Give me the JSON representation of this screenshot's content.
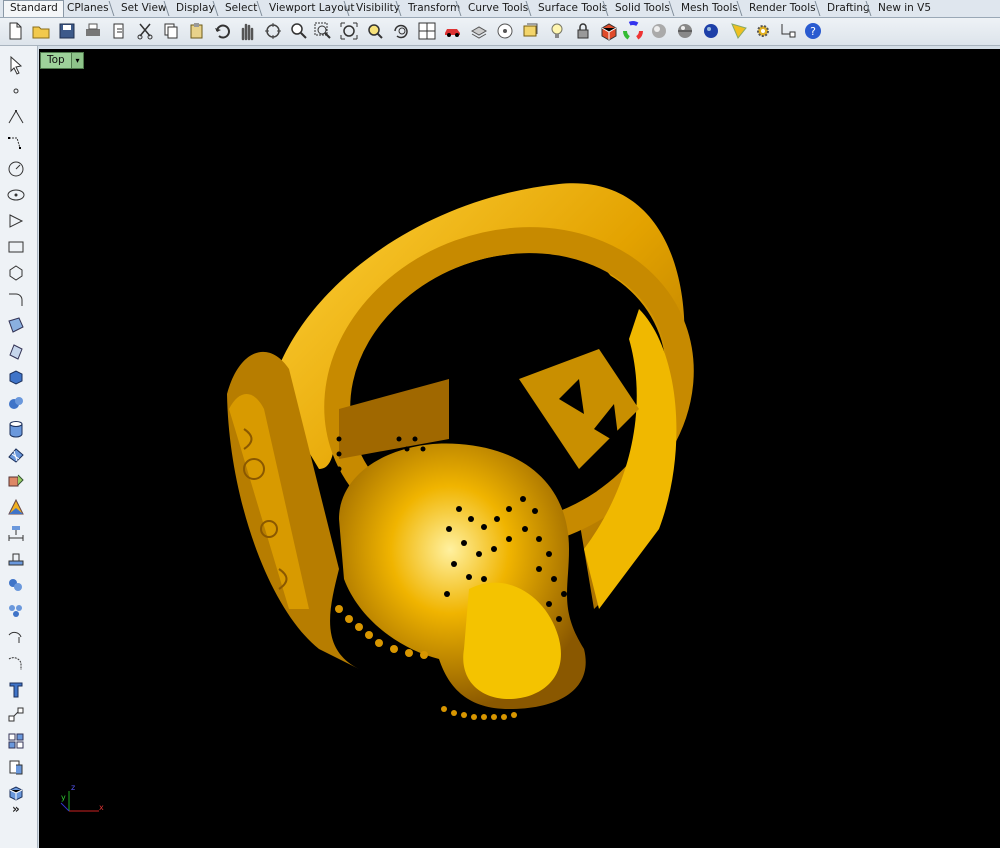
{
  "tabs": [
    {
      "label": "Standard",
      "active": true
    },
    {
      "label": "CPlanes"
    },
    {
      "label": "Set View"
    },
    {
      "label": "Display"
    },
    {
      "label": "Select"
    },
    {
      "label": "Viewport Layout"
    },
    {
      "label": "Visibility"
    },
    {
      "label": "Transform"
    },
    {
      "label": "Curve Tools"
    },
    {
      "label": "Surface Tools"
    },
    {
      "label": "Solid Tools"
    },
    {
      "label": "Mesh Tools"
    },
    {
      "label": "Render Tools"
    },
    {
      "label": "Drafting"
    },
    {
      "label": "New in V5"
    }
  ],
  "toolbar_icons": [
    "new-icon",
    "open-icon",
    "save-icon",
    "print-icon",
    "import-icon",
    "cut-icon",
    "copy-icon",
    "paste-icon",
    "undo-icon",
    "pan-icon",
    "rotate-view-icon",
    "zoom-icon",
    "zoom-window-icon",
    "zoom-extents-icon",
    "zoom-selected-icon",
    "undo-view-icon",
    "four-viewports-icon",
    "car-icon",
    "layers-icon",
    "object-properties-icon",
    "named-cplanes-icon",
    "light-icon",
    "lock-icon",
    "wireframe-shade-icon",
    "color-wheel-icon",
    "shaded-sphere-icon",
    "rendered-sphere-icon",
    "render-icon",
    "material-icon",
    "settings-icon",
    "snap-icon",
    "help-icon"
  ],
  "left_icons": [
    "select-arrow-icon",
    "point-icon",
    "polyline-icon",
    "curve-icon",
    "circle-icon",
    "ellipse-icon",
    "arc-icon",
    "rectangle-icon",
    "polygon-icon",
    "fillet-icon",
    "surface-from-points-icon",
    "extrude-icon",
    "box-icon",
    "sphere-icon",
    "cylinder-icon",
    "mesh-icon",
    "transform-icon",
    "analyze-icon",
    "dimension-icon",
    "group-icon",
    "array-icon",
    "explode-icon",
    "split-icon",
    "text-icon",
    "move-icon",
    "align-icon",
    "boolean-icon",
    "render-mesh-icon"
  ],
  "viewport": {
    "label": "Top",
    "dropdown": "▾",
    "background": "#000000",
    "model_color": "#e8a800"
  },
  "axis": {
    "x": "x",
    "y": "y",
    "z": "z"
  },
  "more_label": "»",
  "colors": {
    "accent": "#9ed29a",
    "toolbar": "#dde4eb",
    "gold": "#e3a200"
  }
}
